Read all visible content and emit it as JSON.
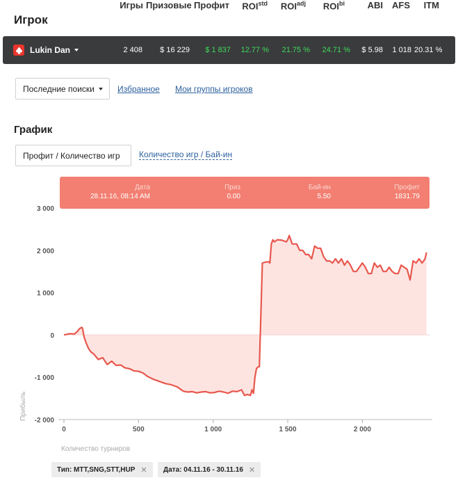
{
  "header": {
    "title": "Игрок",
    "columns": [
      {
        "label": "Игры",
        "sup": ""
      },
      {
        "label": "Призовые",
        "sup": ""
      },
      {
        "label": "Профит",
        "sup": ""
      },
      {
        "label": "ROI",
        "sup": "std"
      },
      {
        "label": "ROI",
        "sup": "adj"
      },
      {
        "label": "ROI",
        "sup": "bi"
      },
      {
        "label": "ABI",
        "sup": ""
      },
      {
        "label": "AFS",
        "sup": ""
      },
      {
        "label": "ITM",
        "sup": ""
      }
    ]
  },
  "player": {
    "name": "Lukin Dan",
    "logo_icon": "pokerstars-spade-icon",
    "stats": [
      "2 408",
      "$ 16 229",
      "$ 1 837",
      "12.77 %",
      "21.75 %",
      "24.71 %",
      "$ 5.98",
      "1 018",
      "20.31 %"
    ]
  },
  "toolbar": {
    "dropdown_label": "Последние поиски",
    "link_favorites": "Избранное",
    "link_groups": "Мои группы игроков"
  },
  "graph": {
    "title": "График",
    "tab_active": "Профит / Количество игр",
    "tab_other": "Количество игр / Бай-ин"
  },
  "tooltip": {
    "labels": [
      "Дата",
      "Приз",
      "Бай-ин",
      "Профит"
    ],
    "values": [
      "28.11.16, 08:14 AM",
      "0.00",
      "5.50",
      "1831.79"
    ]
  },
  "filters": [
    {
      "label": "Тип: MTT,SNG,STT,HUP"
    },
    {
      "label": "Дата: 04.11.16 - 30.11.16"
    }
  ],
  "colors": {
    "line": "#e8574d",
    "fill": "#fde4e1",
    "tooltip_bg": "#f27f72",
    "positive": "#3ddc5a",
    "bar_bg": "#3a3b3d"
  },
  "chart_data": {
    "type": "area",
    "xlabel": "Количество турниров",
    "ylabel": "Прибыль",
    "xlim": [
      0,
      2450
    ],
    "ylim": [
      -2000,
      3000
    ],
    "x_ticks": [
      "0",
      "500",
      "1 000",
      "1 500",
      "2 000"
    ],
    "x_tick_values": [
      0,
      500,
      1000,
      1500,
      2000
    ],
    "y_ticks": [
      "3 000",
      "2 000",
      "1 000",
      "0",
      "-1 000",
      "-2 000"
    ],
    "y_tick_values": [
      3000,
      2000,
      1000,
      0,
      -1000,
      -2000
    ],
    "x": [
      0,
      40,
      70,
      90,
      105,
      120,
      125,
      135,
      150,
      165,
      180,
      200,
      230,
      260,
      290,
      320,
      350,
      380,
      410,
      440,
      470,
      500,
      530,
      560,
      600,
      640,
      680,
      720,
      760,
      800,
      830,
      860,
      890,
      920,
      950,
      980,
      1010,
      1040,
      1070,
      1100,
      1130,
      1160,
      1190,
      1210,
      1230,
      1250,
      1260,
      1270,
      1280,
      1290,
      1295,
      1300,
      1310,
      1330,
      1350,
      1370,
      1380,
      1390,
      1400,
      1410,
      1430,
      1460,
      1490,
      1500,
      1510,
      1530,
      1560,
      1580,
      1600,
      1620,
      1640,
      1660,
      1680,
      1700,
      1720,
      1740,
      1760,
      1780,
      1800,
      1820,
      1840,
      1860,
      1880,
      1900,
      1920,
      1940,
      1960,
      1980,
      2000,
      2020,
      2040,
      2060,
      2080,
      2100,
      2120,
      2140,
      2160,
      2180,
      2200,
      2220,
      2240,
      2260,
      2280,
      2300,
      2320,
      2340,
      2360,
      2380,
      2400,
      2420,
      2430
    ],
    "values": [
      0,
      30,
      20,
      80,
      150,
      180,
      150,
      -50,
      -200,
      -320,
      -400,
      -450,
      -580,
      -540,
      -700,
      -620,
      -720,
      -710,
      -780,
      -800,
      -850,
      -860,
      -900,
      -980,
      -1050,
      -1100,
      -1150,
      -1180,
      -1230,
      -1330,
      -1350,
      -1340,
      -1370,
      -1350,
      -1340,
      -1370,
      -1360,
      -1330,
      -1350,
      -1380,
      -1330,
      -1340,
      -1300,
      -1430,
      -1410,
      -1430,
      -1300,
      -1380,
      -1000,
      -800,
      -780,
      -760,
      -750,
      1700,
      1720,
      1730,
      1700,
      2150,
      2250,
      2200,
      2250,
      2240,
      2200,
      2250,
      2350,
      2150,
      2150,
      2000,
      2000,
      1900,
      1900,
      1800,
      2100,
      2050,
      2050,
      1850,
      1750,
      1750,
      1700,
      1800,
      1700,
      1800,
      1650,
      1750,
      1650,
      1500,
      1500,
      1600,
      1700,
      1600,
      1450,
      1450,
      1700,
      1600,
      1650,
      1500,
      1500,
      1600,
      1500,
      1450,
      1450,
      1650,
      1600,
      1550,
      1300,
      1750,
      1700,
      1800,
      1700,
      1800,
      1950,
      1900,
      1830
    ],
    "legend": "none",
    "grid": false
  }
}
